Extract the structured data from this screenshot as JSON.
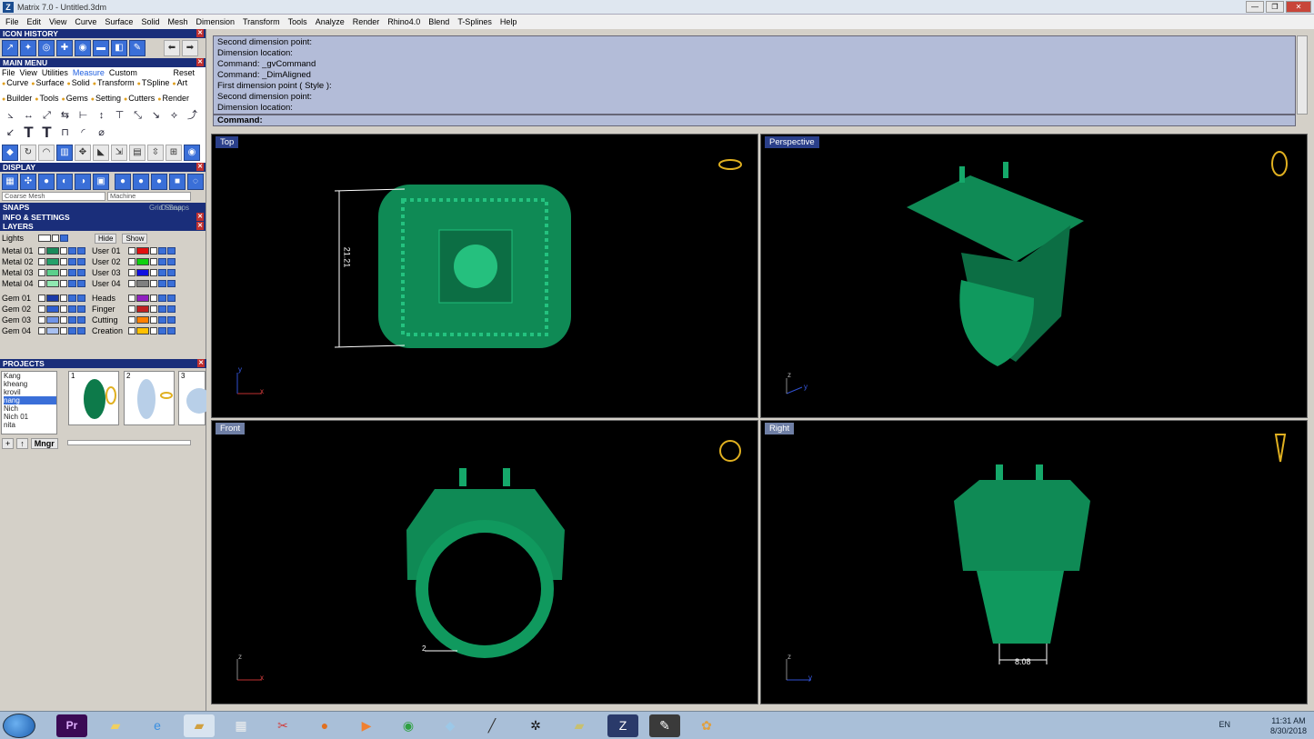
{
  "window": {
    "title": "Matrix 7.0 - Untitled.3dm",
    "app_icon": "Z",
    "min": "—",
    "restore": "❐",
    "close": "✕"
  },
  "menu": [
    "File",
    "Edit",
    "View",
    "Curve",
    "Surface",
    "Solid",
    "Mesh",
    "Dimension",
    "Transform",
    "Tools",
    "Analyze",
    "Render",
    "Rhino4.0",
    "Blend",
    "T-Splines",
    "Help"
  ],
  "sections": {
    "icon_history": "ICON HISTORY",
    "main_menu": "MAIN MENU",
    "display": "DISPLAY",
    "snaps": "SNAPS",
    "info": "INFO & SETTINGS",
    "layers": "LAYERS",
    "projects": "PROJECTS"
  },
  "main_menu_tabs": [
    "File",
    "View",
    "Utilities",
    "Measure",
    "Custom",
    "Reset"
  ],
  "main_menu_categories": [
    "Curve",
    "Surface",
    "Solid",
    "Transform",
    "TSpline",
    "Art",
    "Builder",
    "Tools",
    "Gems",
    "Setting",
    "Cutters",
    "Render"
  ],
  "display": {
    "mesh": "Coarse Mesh",
    "material": "Machine"
  },
  "snaps": {
    "grid": "Grid Snap",
    "osnaps": "O-Snaps"
  },
  "layers": {
    "lights": "Lights",
    "hide": "Hide",
    "show": "Show",
    "left": [
      {
        "name": "Metal 01",
        "color": "#1a8a5a"
      },
      {
        "name": "Metal 02",
        "color": "#24a06a"
      },
      {
        "name": "Metal 03",
        "color": "#5cd08c"
      },
      {
        "name": "Metal 04",
        "color": "#8fe8b0"
      },
      {
        "name": "Gem 01",
        "color": "#1a3aa8"
      },
      {
        "name": "Gem 02",
        "color": "#2f5ed0"
      },
      {
        "name": "Gem 03",
        "color": "#6f94e8"
      },
      {
        "name": "Gem 04",
        "color": "#a8c0f0"
      }
    ],
    "right": [
      {
        "name": "User 01",
        "color": "#e01010"
      },
      {
        "name": "User 02",
        "color": "#10d010"
      },
      {
        "name": "User 03",
        "color": "#1010e0"
      },
      {
        "name": "User 04",
        "color": "#808080"
      },
      {
        "name": "Heads",
        "color": "#9020c0"
      },
      {
        "name": "Finger",
        "color": "#c02020"
      },
      {
        "name": "Cutting",
        "color": "#ff8000"
      },
      {
        "name": "Creation",
        "color": "#ffc000"
      }
    ]
  },
  "projects": {
    "list": [
      "Kang",
      "kheang",
      "krovil",
      "nang",
      "Nich",
      "Nich 01",
      "nita"
    ],
    "selected": "nang",
    "thumbs": [
      "1",
      "2",
      "3"
    ],
    "mngr": "Mngr"
  },
  "command_history": [
    "Second dimension point:",
    "Dimension location:",
    "Command: _gvCommand",
    "Command: _DimAligned",
    "First dimension point ( Style ):",
    "Second dimension point:",
    "Dimension location:"
  ],
  "command_prompt": "Command:",
  "viewports": {
    "top": {
      "label": "Top",
      "dim": "21.21",
      "axis_a": "y",
      "axis_b": "x"
    },
    "perspective": {
      "label": "Perspective",
      "axis_a": "z",
      "axis_b": "y"
    },
    "front": {
      "label": "Front",
      "dim": "2",
      "axis_a": "z",
      "axis_b": "x"
    },
    "right": {
      "label": "Right",
      "dim": "8.08",
      "axis_a": "z",
      "axis_b": "y"
    }
  },
  "taskbar": {
    "lang": "EN",
    "time": "11:31 AM",
    "date": "8/30/2018",
    "pr": "Pr"
  }
}
